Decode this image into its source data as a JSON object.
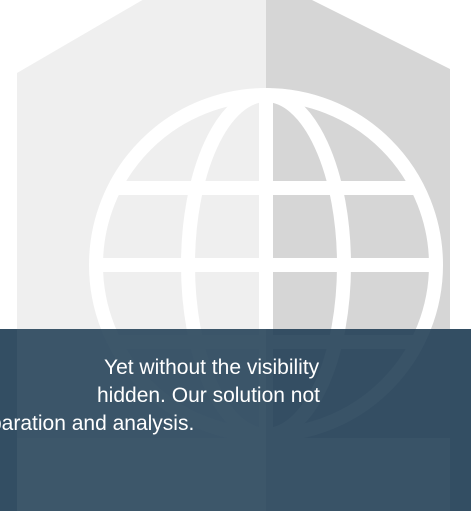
{
  "caption": {
    "lines": [
      "Yet without the visibility",
      "hidden. Our solution not",
      "paration and analysis."
    ]
  },
  "colors": {
    "background": "#ffffff",
    "emblem_light": "#efefef",
    "emblem_dark": "#d6d6d6",
    "band_overlay": "#17364d",
    "text": "#ffffff"
  },
  "icons": {
    "emblem": "house-globe-icon"
  }
}
